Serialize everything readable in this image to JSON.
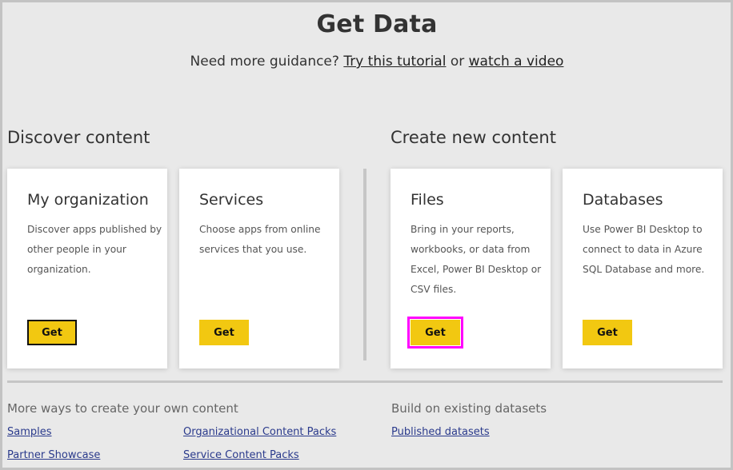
{
  "header": {
    "title": "Get Data",
    "guidance_prefix": "Need more guidance?",
    "tutorial_link": "Try this tutorial",
    "or": "or",
    "video_link": "watch a video"
  },
  "discover": {
    "title": "Discover content",
    "cards": [
      {
        "title": "My organization",
        "description": "Discover apps published by other people in your organization.",
        "button": "Get"
      },
      {
        "title": "Services",
        "description": "Choose apps from online services that you use.",
        "button": "Get"
      }
    ]
  },
  "create": {
    "title": "Create new content",
    "cards": [
      {
        "title": "Files",
        "description": "Bring in your reports, workbooks, or data from Excel, Power BI Desktop or CSV files.",
        "button": "Get"
      },
      {
        "title": "Databases",
        "description": "Use Power BI Desktop to connect to data in Azure SQL Database and more.",
        "button": "Get"
      }
    ]
  },
  "more_ways": {
    "title": "More ways to create your own content",
    "links": [
      "Samples",
      "Organizational Content Packs",
      "Partner Showcase",
      "Service Content Packs"
    ]
  },
  "existing": {
    "title": "Build on existing datasets",
    "links": [
      "Published datasets"
    ]
  },
  "colors": {
    "accent_button": "#f2c811",
    "highlight": "#ff00ff",
    "background": "#e9e9e9"
  }
}
